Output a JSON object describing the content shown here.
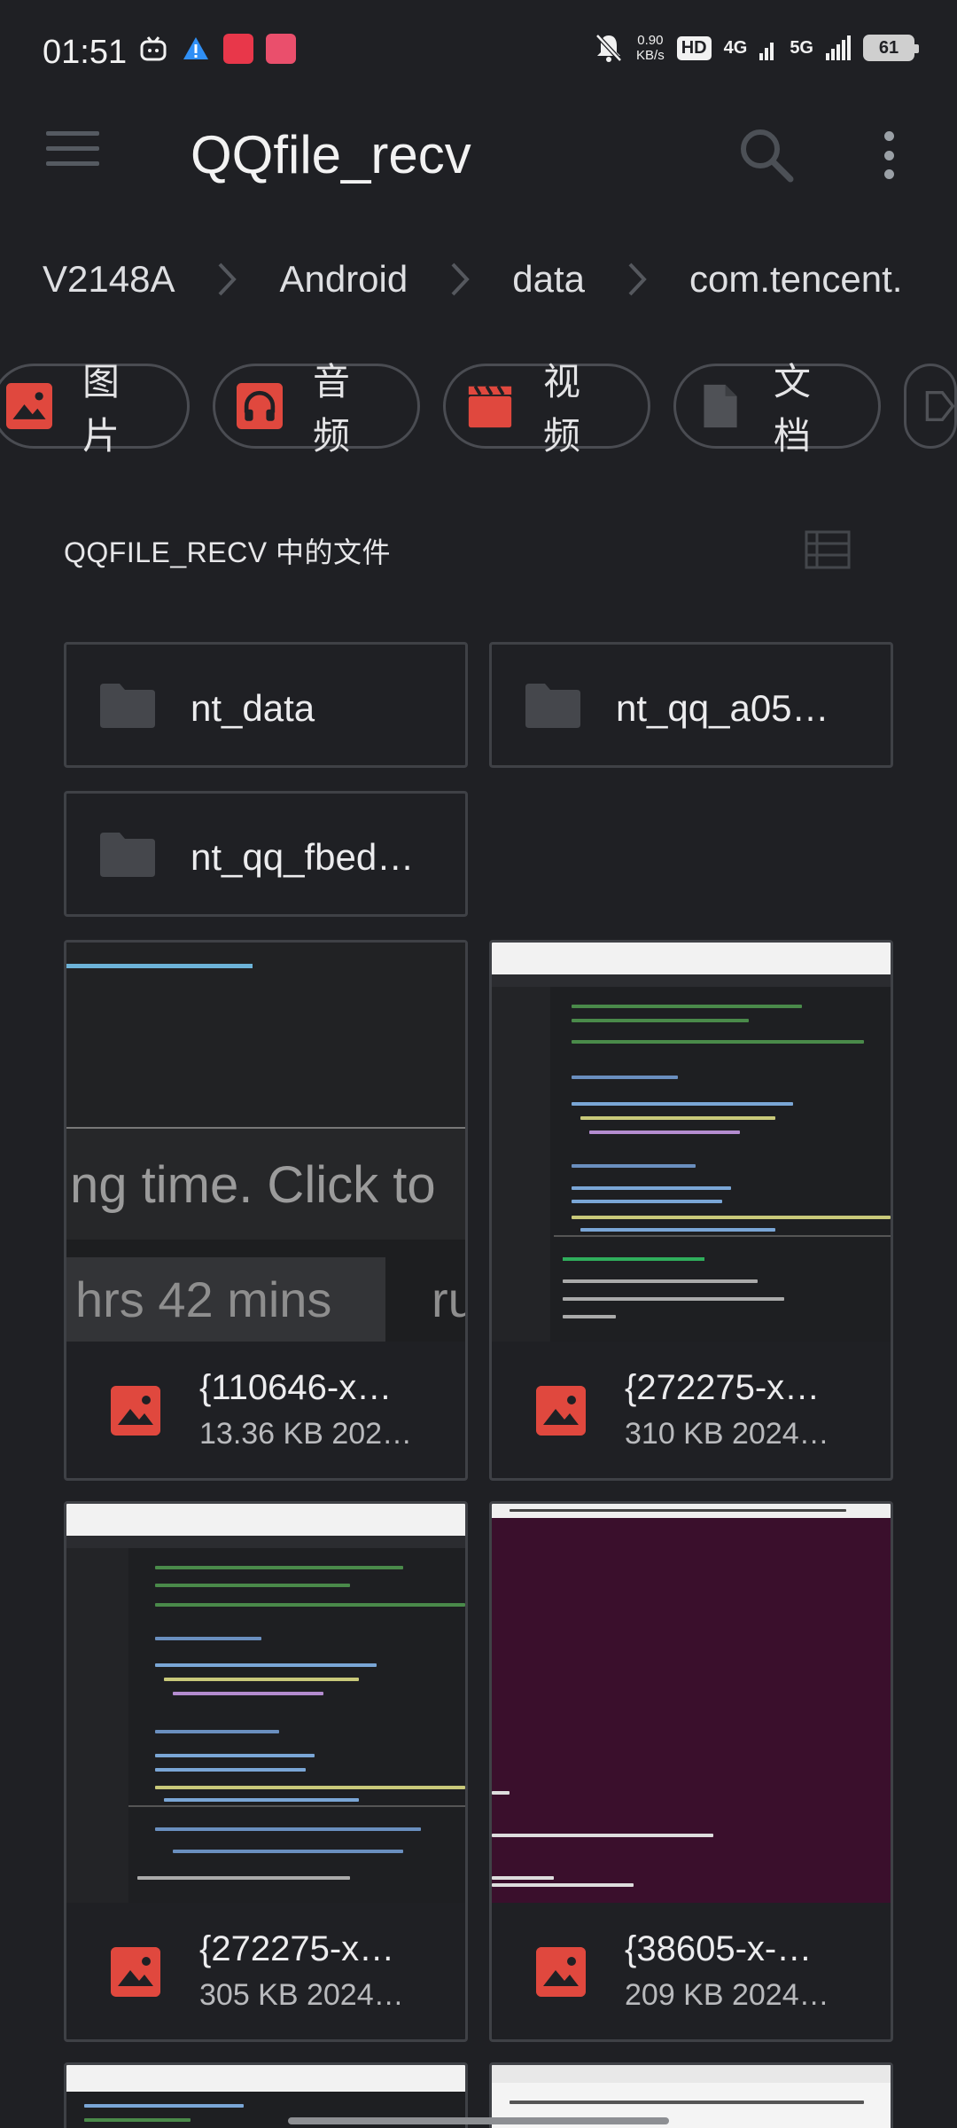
{
  "status_bar": {
    "time": "01:51",
    "speed_value": "0.90",
    "speed_unit": "KB/s",
    "hd_tag": "HD",
    "net1": "4G",
    "net2": "5G",
    "battery": "61"
  },
  "app_bar": {
    "title": "QQfile_recv",
    "menu_icon": "menu-icon",
    "search_icon": "search-icon",
    "more_icon": "more-vert-icon"
  },
  "breadcrumb": [
    "V2148A",
    "Android",
    "data",
    "com.tencent."
  ],
  "chips": [
    {
      "label": "图片",
      "icon": "image-icon",
      "color": "#e0483e"
    },
    {
      "label": "音频",
      "icon": "headphones-icon",
      "color": "#e0483e"
    },
    {
      "label": "视频",
      "icon": "clapperboard-icon",
      "color": "#e0483e"
    },
    {
      "label": "文档",
      "icon": "document-icon",
      "color": "#4f5156"
    }
  ],
  "section": {
    "title": "QQFILE_RECV 中的文件"
  },
  "folders": [
    {
      "name": "nt_data"
    },
    {
      "name": "nt_qq_a05…"
    },
    {
      "name": "nt_qq_fbed…"
    }
  ],
  "files": [
    {
      "name": "{110646-x…",
      "meta": "13.36 KB 202…",
      "thumb_text1": "ng time. Click to",
      "thumb_text2": "hrs 42 mins",
      "thumb_text3": "ru"
    },
    {
      "name": "{272275-x…",
      "meta": "310 KB 2024…"
    },
    {
      "name": "{272275-x…",
      "meta": "305 KB 2024…"
    },
    {
      "name": "{38605-x-…",
      "meta": "209 KB 2024…"
    }
  ],
  "colors": {
    "background": "#1f2024",
    "accent_red": "#e0483e",
    "tile_border": "#3f4146"
  }
}
